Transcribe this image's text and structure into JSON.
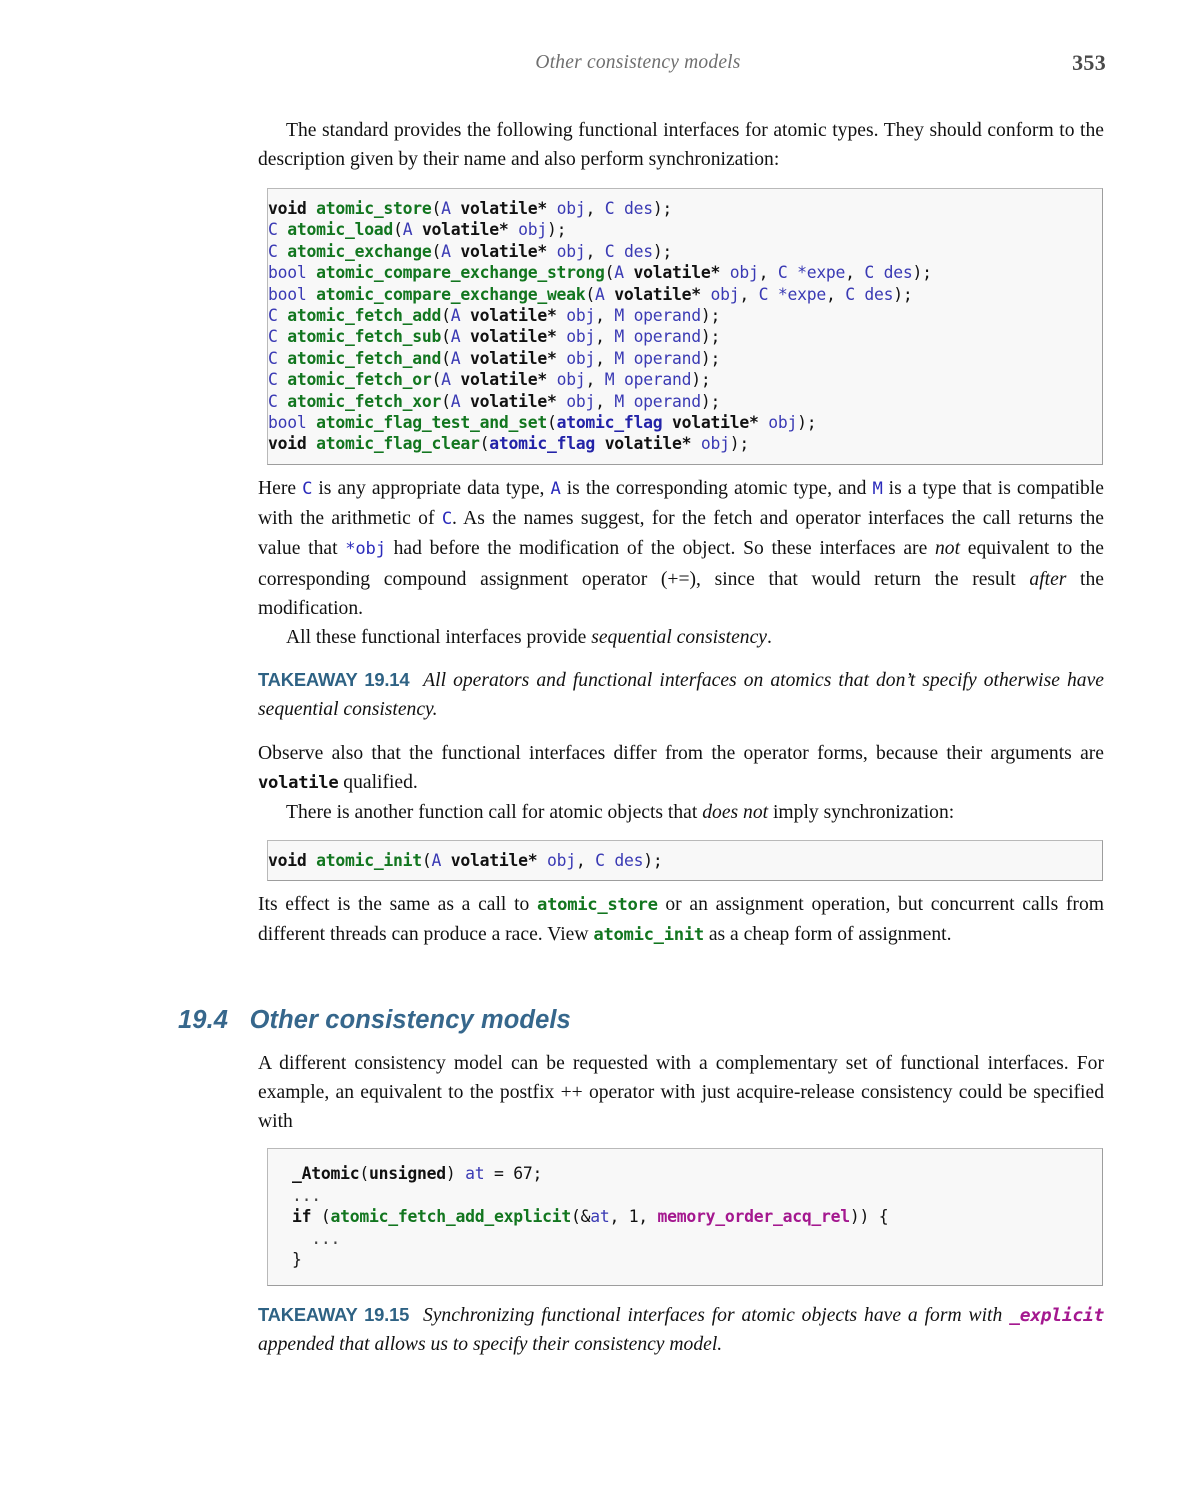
{
  "header": {
    "running_title": "Other consistency models",
    "page_number": "353"
  },
  "paragraphs": {
    "intro": {
      "part1": "The standard provides the following functional interfaces for atomic types.  They should conform to the description given by their name and also perform synchronization:"
    },
    "here": {
      "s1": "Here ",
      "c1": "C",
      "s2": " is any appropriate data type, ",
      "a1": "A",
      "s3": " is the corresponding atomic type, and ",
      "m1": "M",
      "s4": " is a type that is compatible with the arithmetic of ",
      "c2": "C",
      "s5": ".  As the names suggest, for the fetch and operator interfaces the call returns the value that ",
      "obj": "*obj",
      "s6": " had before the modification of the object. So these interfaces are ",
      "not": "not",
      "s7": " equivalent to the corresponding compound assignment operator (+=), since that would return the result ",
      "after": "after",
      "s8": " the modification."
    },
    "all_these": {
      "s1": "All these functional interfaces provide ",
      "em1": "sequential consistency",
      "s2": "."
    },
    "observe": "Observe also that the functional interfaces differ from the operator forms, because their arguments are ",
    "observe_code": "volatile",
    "observe_tail": " qualified.",
    "another_call": {
      "s1": "There is another function call for atomic objects that ",
      "em1": "does not",
      "s2": " imply synchronization:"
    },
    "its_effect": {
      "s1": "Its effect is the same as a call to ",
      "code1": "atomic_store",
      "s2": " or an assignment operation, but concurrent calls from different threads can produce a race.  View ",
      "code2": "atomic_init",
      "s3": " as a cheap form of assignment."
    },
    "different_model": "A different consistency model can be requested with a complementary set of functional interfaces. For example, an equivalent to the postfix ++ operator with just acquire-release consistency could be specified with"
  },
  "takeaways": {
    "t1914": {
      "label": "TAKEAWAY 19.14",
      "text": "All operators and functional interfaces on atomics that don’t specify otherwise have sequential consistency."
    },
    "t1915": {
      "label": "TAKEAWAY 19.15",
      "s1": "Synchronizing functional interfaces for atomic objects have a form with ",
      "code": "_explicit",
      "s2": " appended that allows us to specify their consistency model."
    }
  },
  "section": {
    "number": "19.4",
    "title": "Other consistency models"
  },
  "code_blocks": {
    "interfaces": {
      "lines": [
        "void atomic_store(A volatile* obj, C des);",
        "C atomic_load(A volatile* obj);",
        "C atomic_exchange(A volatile* obj, C des);",
        "bool atomic_compare_exchange_strong(A volatile* obj, C *expe, C des);",
        "bool atomic_compare_exchange_weak(A volatile* obj, C *expe, C des);",
        "C atomic_fetch_add(A volatile* obj, M operand);",
        "C atomic_fetch_sub(A volatile* obj, M operand);",
        "C atomic_fetch_and(A volatile* obj, M operand);",
        "C atomic_fetch_or(A volatile* obj, M operand);",
        "C atomic_fetch_xor(A volatile* obj, M operand);",
        "bool atomic_flag_test_and_set(atomic_flag volatile* obj);",
        "void atomic_flag_clear(atomic_flag volatile* obj);"
      ]
    },
    "atomic_init": {
      "lines": [
        "void atomic_init(A volatile* obj, C des);"
      ]
    },
    "explicit_example": {
      "lines": [
        "_Atomic(unsigned) at = 67;",
        "...",
        "if (atomic_fetch_add_explicit(&at, 1, memory_order_acq_rel)) {",
        "  ...",
        "}"
      ]
    }
  },
  "colors": {
    "accent_blue": "#36678c",
    "takeaway_blue": "#2e6284",
    "code_function_green": "#12761f",
    "code_identifier_blue": "#3a3ab4",
    "code_memory_order_magenta": "#a4188f",
    "code_background": "#f8f8f8",
    "code_border": "#b9b9b9"
  }
}
